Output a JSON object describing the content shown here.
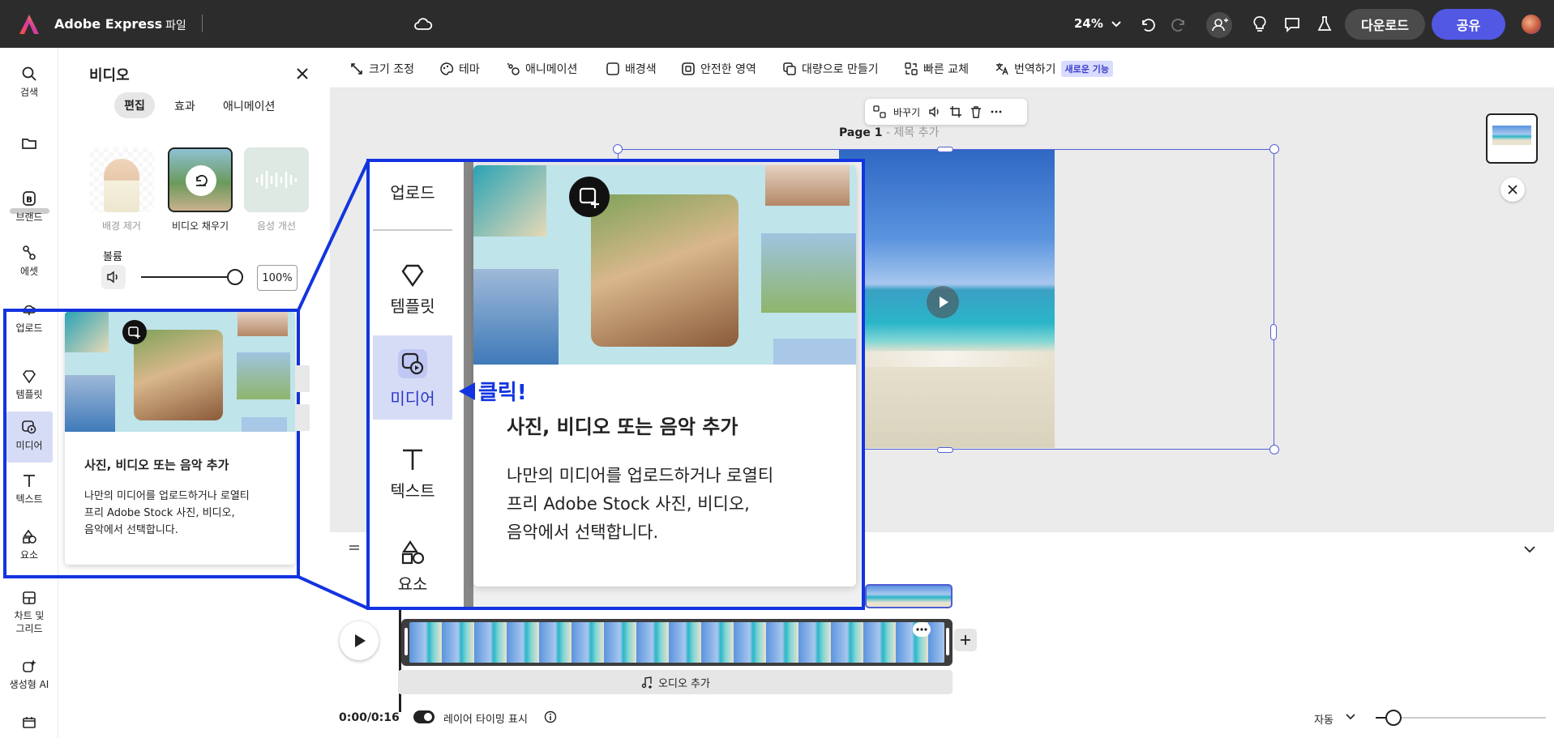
{
  "app": {
    "title": "Adobe Express",
    "file_menu": "파일",
    "zoom": "24%"
  },
  "topbar": {
    "download": "다운로드",
    "share": "공유",
    "colors": {
      "share_bg": "#5258e4",
      "download_bg": "#4b4b4b"
    }
  },
  "rail": {
    "search": "검색",
    "brand": "브랜드",
    "assets": "에셋",
    "upload": "업로드",
    "templates": "템플릿",
    "media": "미디어",
    "text": "텍스트",
    "elements": "요소",
    "charts": "차트 및 그리드",
    "ai": "생성형 AI"
  },
  "panel": {
    "title": "비디오",
    "tabs": [
      "편집",
      "효과",
      "애니메이션"
    ],
    "options": [
      "배경 제거",
      "비디오 채우기",
      "음성 개선"
    ],
    "volume_label": "볼륨",
    "volume_value": "100%",
    "volume_level": 1.0
  },
  "toolbar": {
    "items": [
      "크기 조정",
      "테마",
      "애니메이션",
      "배경색",
      "안전한 영역",
      "대량으로 만들기",
      "빠른 교체",
      "번역하기"
    ],
    "new_badge": "새로운 기능"
  },
  "canvas": {
    "page_label": "Page 1",
    "page_sub": "- 제목 추가",
    "float_replace": "바꾸기"
  },
  "tooltip": {
    "title": "사진, 비디오 또는 음악 추가",
    "body_lines": [
      "나만의 미디어를 업로드하거나 로열티",
      "프리 Adobe Stock 사진, 비디오,",
      "음악에서 선택합니다."
    ]
  },
  "zoomcallout": {
    "upload": "업로드",
    "templates": "템플릿",
    "media": "미디어",
    "text": "텍스트",
    "elements": "요소",
    "click": "클릭!",
    "title": "사진, 비디오 또는 음악 추가",
    "body_lines": [
      "나만의 미디어를 업로드하거나 로열티",
      "프리 Adobe Stock 사진, 비디오,",
      "음악에서 선택합니다."
    ]
  },
  "timeline": {
    "time": "0:00/0:16",
    "layer_timing": "레이어 타이밍 표시",
    "add_audio": "오디오 추가",
    "zoom_mode": "자동"
  }
}
